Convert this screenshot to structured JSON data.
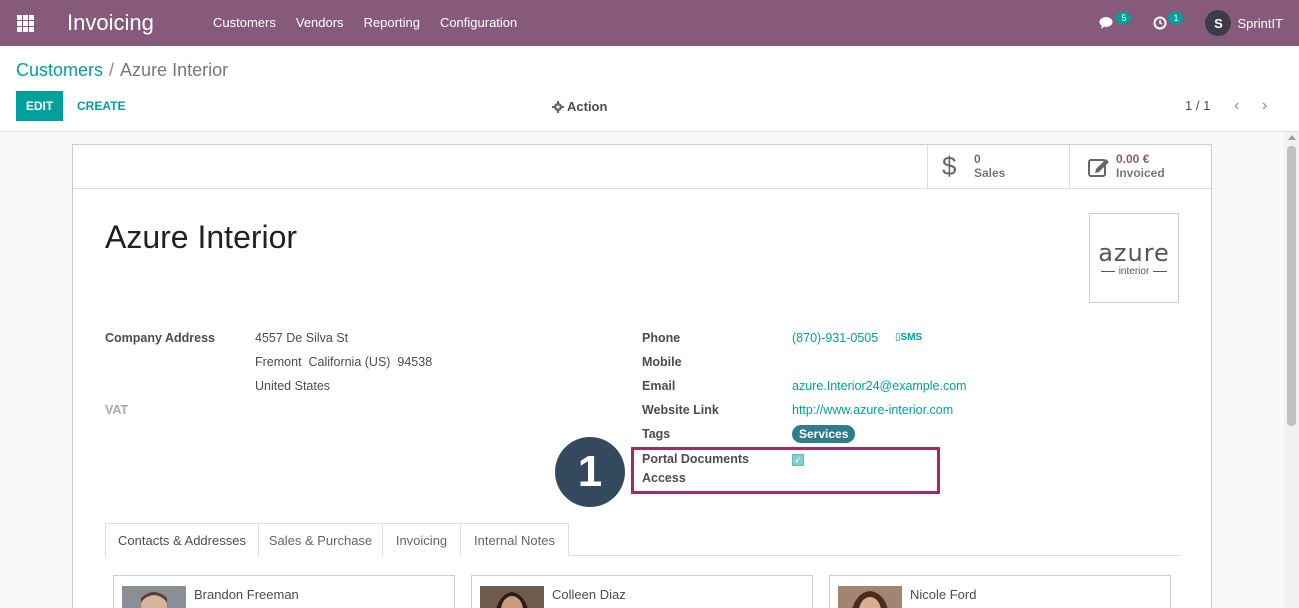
{
  "app": {
    "title": "Invoicing"
  },
  "menu": [
    "Customers",
    "Vendors",
    "Reporting",
    "Configuration"
  ],
  "systray": {
    "messages_count": "5",
    "activities_count": "1",
    "avatar_letter": "S",
    "username": "SprintIT"
  },
  "breadcrumb": {
    "parent": "Customers",
    "current": "Azure Interior"
  },
  "toolbar": {
    "edit_label": "EDIT",
    "create_label": "CREATE",
    "action_label": "Action"
  },
  "pager": {
    "value": "1 / 1"
  },
  "stat_buttons": {
    "sales": {
      "value": "0",
      "label": "Sales"
    },
    "invoiced": {
      "value": "0.00 €",
      "label": "Invoiced"
    }
  },
  "record": {
    "name": "Azure Interior"
  },
  "logo": {
    "main": "azure",
    "sub": "interior"
  },
  "address": {
    "label": "Company Address",
    "line1": "4557 De Silva St",
    "line2": "Fremont  California (US)  94538",
    "line3": "United States",
    "vat_label": "VAT"
  },
  "contact": {
    "phone_label": "Phone",
    "phone_value": "(870)-931-0505",
    "sms_label": "SMS",
    "mobile_label": "Mobile",
    "email_label": "Email",
    "email_value": "azure.Interior24@example.com",
    "website_label": "Website Link",
    "website_value": "http://www.azure-interior.com",
    "tags_label": "Tags",
    "tag_value": "Services",
    "portal_label_1": "Portal Documents",
    "portal_label_2": "Access",
    "portal_checked": true
  },
  "step_marker": "1",
  "tabs": [
    "Contacts & Addresses",
    "Sales & Purchase",
    "Invoicing",
    "Internal Notes"
  ],
  "contacts": [
    "Brandon Freeman",
    "Colleen Diaz",
    "Nicole Ford"
  ],
  "colors": {
    "primary": "#875a7b",
    "accent": "#00a09d",
    "highlight": "#a3296d",
    "marker": "#34495e"
  }
}
